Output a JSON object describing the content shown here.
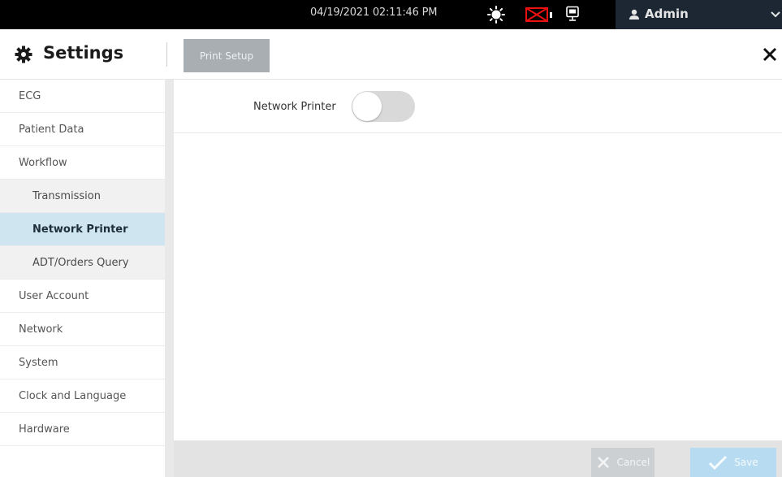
{
  "status_bar": {
    "datetime": "04/19/2021 02:11:46 PM",
    "icons": [
      "sun-icon",
      "mail-error-icon",
      "monitor-icon"
    ],
    "user": {
      "name": "Admin",
      "icon": "user-icon",
      "menu_icon": "chevron-down-icon"
    }
  },
  "header": {
    "title": "Settings",
    "title_icon": "gear-icon",
    "tabs": [
      {
        "label": "Print Setup"
      }
    ],
    "close_icon": "close-icon"
  },
  "sidebar": {
    "items": [
      {
        "label": "ECG"
      },
      {
        "label": "Patient Data"
      },
      {
        "label": "Workflow"
      },
      {
        "label": "Transmission"
      },
      {
        "label": "Network Printer",
        "selected": true
      },
      {
        "label": "ADT/Orders Query"
      },
      {
        "label": "User Account"
      },
      {
        "label": "Network"
      },
      {
        "label": "System"
      },
      {
        "label": "Clock and Language"
      },
      {
        "label": "Hardware"
      }
    ]
  },
  "main": {
    "network_printer": {
      "label": "Network Printer",
      "enabled": false
    }
  },
  "footer": {
    "cancel_label": "Cancel",
    "save_label": "Save"
  },
  "colors": {
    "topbar": "#000000",
    "user_panel": "#1c2733",
    "selected_nav": "#cfe6f1",
    "save_button": "#b7dbf0",
    "cancel_button": "#cdd0d3",
    "tab_button": "#a9aeb2"
  }
}
